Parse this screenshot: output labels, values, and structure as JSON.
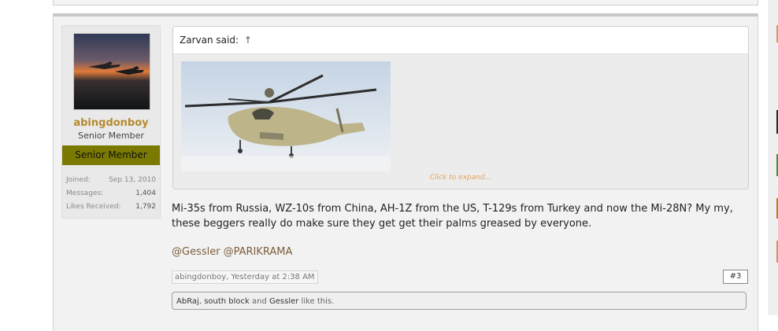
{
  "user": {
    "username": "abingdonboy",
    "user_title": "Senior Member",
    "ribbon": "Senior Member",
    "stats": [
      {
        "label": "Joined:",
        "value": "Sep 13, 2010"
      },
      {
        "label": "Messages:",
        "value": "1,404"
      },
      {
        "label": "Likes Received:",
        "value": "1,792"
      }
    ]
  },
  "quote": {
    "author": "Zarvan said:",
    "arrow": "↑",
    "expand": "Click to expand..."
  },
  "message": {
    "text": "Mi-35s from Russia, WZ-10s from China, AH-1Z from the US, T-129s from Turkey and now the Mi-28N? My my, these beggers really do make sure they get get their palms greased by everyone.",
    "mentions": [
      "@Gessler",
      "@PARIKRAMA"
    ]
  },
  "meta": {
    "author_time": "abingdonboy, Yesterday at 2:38 AM",
    "post_number": "#3"
  },
  "likes": {
    "user1": "AbRaj",
    "sep1": ", ",
    "user2": "south block",
    "sep2": " and ",
    "user3": "Gessler",
    "suffix": " like this."
  },
  "colors": {
    "username": "#b48a2e",
    "ribbon_bg": "#7a7a00",
    "mention": "#7a5e39",
    "expand": "#e3a35a"
  }
}
